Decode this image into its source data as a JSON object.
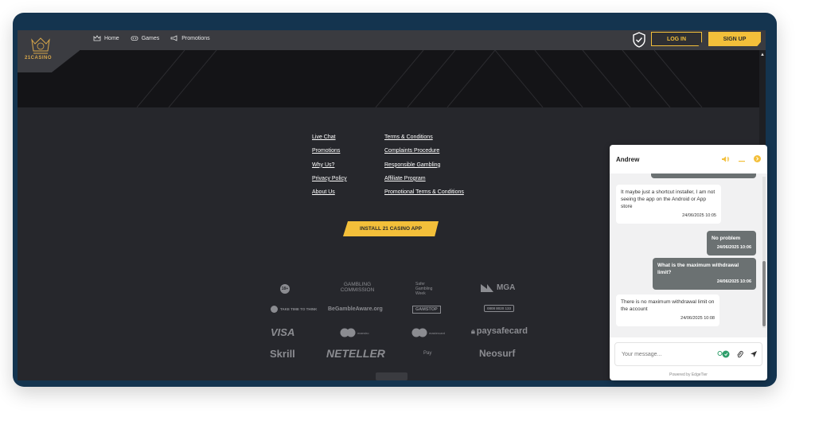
{
  "nav": {
    "logo_text": "21CASINO",
    "links": [
      {
        "label": "Home",
        "icon": "crown-icon"
      },
      {
        "label": "Games",
        "icon": "controller-icon"
      },
      {
        "label": "Promotions",
        "icon": "megaphone-icon"
      }
    ],
    "login_label": "LOG IN",
    "signup_label": "SIGN UP"
  },
  "footer": {
    "col1": [
      "Live Chat",
      "Promotions",
      "Why Us?",
      "Privacy Policy",
      "About Us"
    ],
    "col2": [
      "Terms & Conditions",
      "Complaints Procedure",
      "Responsible Gambling",
      "Affiliate Program",
      "Promotional Terms & Conditions"
    ],
    "install_label": "INSTALL 21 CASINO APP",
    "logos": {
      "age": "18+",
      "gambling_commission": "GAMBLING COMMISSION",
      "safer_gambling": "Safer Gambling Week",
      "mga": "MGA",
      "take_time": "TAKE TIME TO THINK",
      "begamble": "BeGambleAware.org",
      "gamstop": "GAMSTOP",
      "gamcare": "0808 8020 133",
      "visa": "VISA",
      "maestro": "maestro",
      "mastercard": "mastercard",
      "paysafe": "paysafecard",
      "skrill": "Skrill",
      "neteller": "NETELLER",
      "applepay": "Pay",
      "neosurf": "Neosurf"
    }
  },
  "chat": {
    "agent_name": "Andrew",
    "messages": [
      {
        "side": "left",
        "text": "It maybe just a shortcut installer, I am not seeing the app on the Android or App store",
        "time": "24/06/2025 10:05"
      },
      {
        "side": "right",
        "text": "No problem",
        "time": "24/06/2025 10:06"
      },
      {
        "side": "right",
        "text": "What is the maximum withdrawal limit?",
        "time": "24/06/2025 10:06"
      },
      {
        "side": "left",
        "text": "There is no maximum withdrawal limit on the account",
        "time": "24/06/2025 10:08"
      }
    ],
    "input_placeholder": "Your message...",
    "powered_by": "Powered by EdgeTier"
  },
  "colors": {
    "accent": "#f3bf3a",
    "bg": "#26272c",
    "frame": "#14344f"
  }
}
